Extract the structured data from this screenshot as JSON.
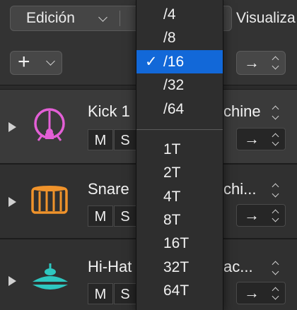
{
  "menubar": {
    "edicion": "Edición",
    "visualizar": "Visualiza"
  },
  "toolbar": {
    "add_symbol": "+"
  },
  "tracks": [
    {
      "name": "Kick 1",
      "name_tail": "chine",
      "mute": "M",
      "solo": "S",
      "icon": "bass-drum-icon",
      "color": "#e35fd6"
    },
    {
      "name": "Snare",
      "name_tail": "chi...",
      "mute": "M",
      "solo": "S",
      "icon": "snare-drum-icon",
      "color": "#f0932b"
    },
    {
      "name": "Hi-Hat",
      "name_tail": "ac...",
      "mute": "M",
      "solo": "S",
      "icon": "hi-hat-icon",
      "color": "#2ec7c0"
    }
  ],
  "arrow_symbol": "→",
  "dropdown": {
    "check": "✓",
    "items": [
      "/4",
      "/8",
      "/16",
      "/32",
      "/64"
    ],
    "selected": "/16",
    "triplets": [
      "1T",
      "2T",
      "4T",
      "8T",
      "16T",
      "32T",
      "64T"
    ]
  }
}
